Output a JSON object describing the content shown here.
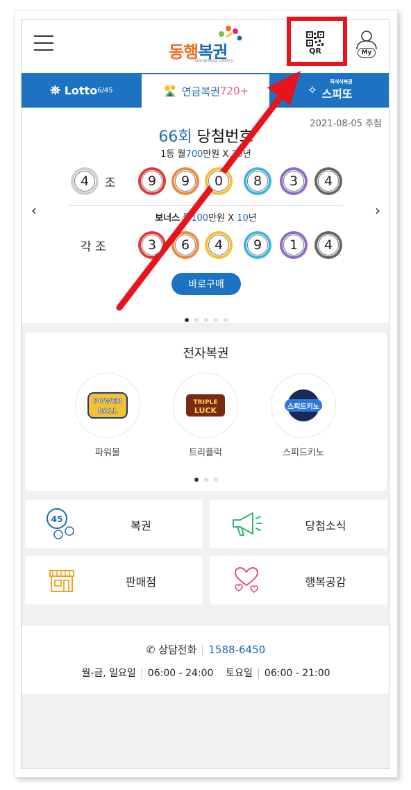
{
  "header": {
    "logo_main": "동행",
    "logo_accent": "복권",
    "logo_sub": "DongHang Lottery",
    "qr_label": "QR",
    "my_label": "My"
  },
  "tabs": [
    {
      "label": "Lotto",
      "sub": "6/45"
    },
    {
      "label": "연금복권",
      "sub": "720+"
    },
    {
      "label": "스피또",
      "sub": "즉석식복권"
    }
  ],
  "draw": {
    "date": "2021-08-05 추첨",
    "round": "66회",
    "title": "당첨번호",
    "prize1_a": "1등 월",
    "prize1_b": "700",
    "prize1_c": "만원 X",
    "prize1_d": "20",
    "prize1_e": "년",
    "group": "4",
    "group_label": "조",
    "numbers": [
      "9",
      "9",
      "0",
      "8",
      "3",
      "4"
    ],
    "bonus_label": "보너스",
    "prize2_a": "월",
    "prize2_b": "100",
    "prize2_c": "만원 X",
    "prize2_d": "10",
    "prize2_e": "년",
    "bonus_group_label": "각 조",
    "bonus_numbers": [
      "3",
      "6",
      "4",
      "9",
      "1",
      "4"
    ],
    "buy_label": "바로구매"
  },
  "ball_colors": [
    "#e8353a",
    "#f08a3a",
    "#f6c02f",
    "#3db3e6",
    "#8d6ac6",
    "#666666"
  ],
  "egames": {
    "title": "전자복권",
    "items": [
      {
        "name": "파워볼",
        "logo_top": "POWER",
        "logo_bottom": "BALL"
      },
      {
        "name": "트리플럭",
        "logo_top": "TRIPLE",
        "logo_bottom": "LUCK"
      },
      {
        "name": "스피드키노",
        "logo_top": "스피드키노",
        "logo_bottom": ""
      }
    ]
  },
  "menu": [
    {
      "label": "복권",
      "icon": "lotto-balls-icon",
      "ball": "45"
    },
    {
      "label": "당첨소식",
      "icon": "megaphone-icon"
    },
    {
      "label": "판매점",
      "icon": "store-icon"
    },
    {
      "label": "행복공감",
      "icon": "hearts-icon"
    }
  ],
  "footer": {
    "tel_label": "상담전화",
    "tel_number": "1588-6450",
    "weekday_label": "월-금, 일요일",
    "weekday_hours": "06:00 - 24:00",
    "sat_label": "토요일",
    "sat_hours": "06:00 - 21:00"
  },
  "accent": "#1d72c2",
  "overlay_color": "#e8141b"
}
